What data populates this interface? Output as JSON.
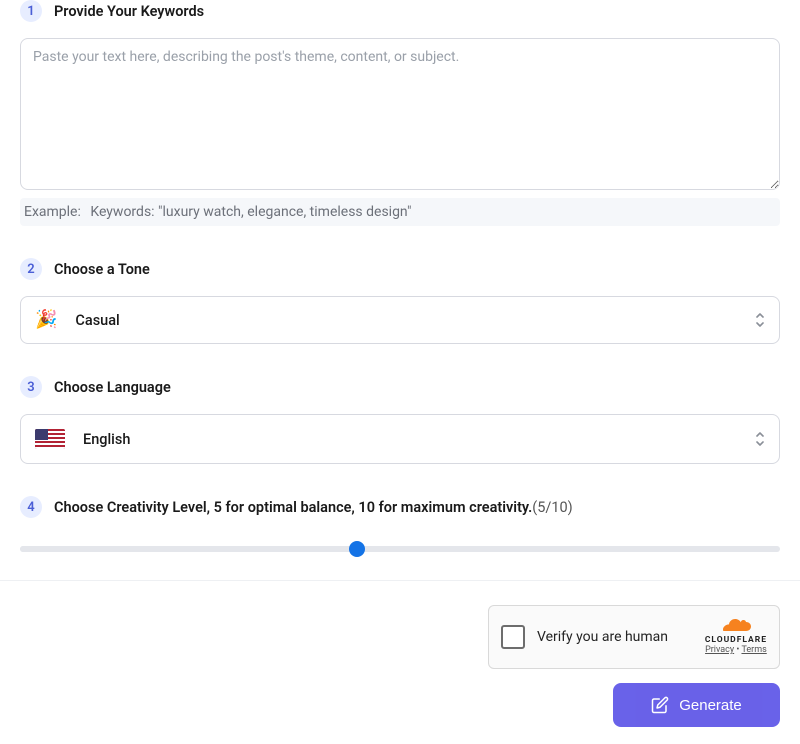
{
  "steps": {
    "s1": {
      "num": "1",
      "title": "Provide Your Keywords"
    },
    "s2": {
      "num": "2",
      "title": "Choose a Tone"
    },
    "s3": {
      "num": "3",
      "title": "Choose Language"
    },
    "s4": {
      "num": "4",
      "title": "Choose Creativity Level, 5 for optimal balance, 10 for maximum creativity.",
      "suffix": "(5/10)"
    }
  },
  "keywords": {
    "placeholder": "Paste your text here, describing the post's theme, content, or subject.",
    "exampleLabel": "Example:",
    "exampleText": "Keywords: \"luxury watch, elegance, timeless design\""
  },
  "tone": {
    "emoji": "🎉",
    "label": "Casual"
  },
  "language": {
    "label": "English"
  },
  "creativity": {
    "value": 5,
    "min": 1,
    "max": 10,
    "percent": 44.4
  },
  "captcha": {
    "label": "Verify you are human",
    "brand": "CLOUDFLARE",
    "privacy": "Privacy",
    "terms": "Terms"
  },
  "generate": {
    "label": "Generate"
  }
}
